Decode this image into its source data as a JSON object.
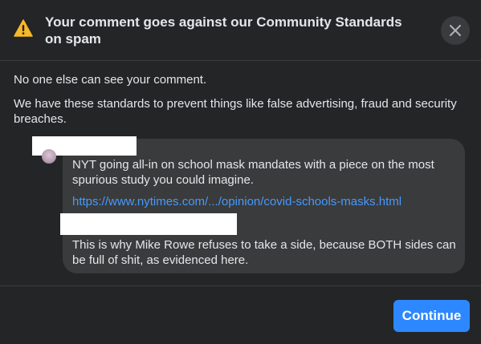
{
  "dialog": {
    "title": "Your comment goes against our Community Standards on spam",
    "close_icon": "close-icon",
    "warning_icon": "warning-triangle-icon"
  },
  "body": {
    "line1": "No one else can see your comment.",
    "line2": "We have these standards to prevent things like false advertising, fraud and security breaches."
  },
  "comment": {
    "text1": "NYT going all-in on school mask mandates with a piece on the most spurious study you could imagine.",
    "link": "https://www.nytimes.com/.../opinion/covid-schools-masks.html",
    "text2": "This is why Mike Rowe refuses to take a side, because BOTH sides can be full of shit, as evidenced here."
  },
  "footer": {
    "continue_label": "Continue"
  },
  "colors": {
    "background": "#242526",
    "bubble": "#3a3b3c",
    "accent": "#2d88ff",
    "link": "#4599ff",
    "warning": "#f7b928"
  }
}
